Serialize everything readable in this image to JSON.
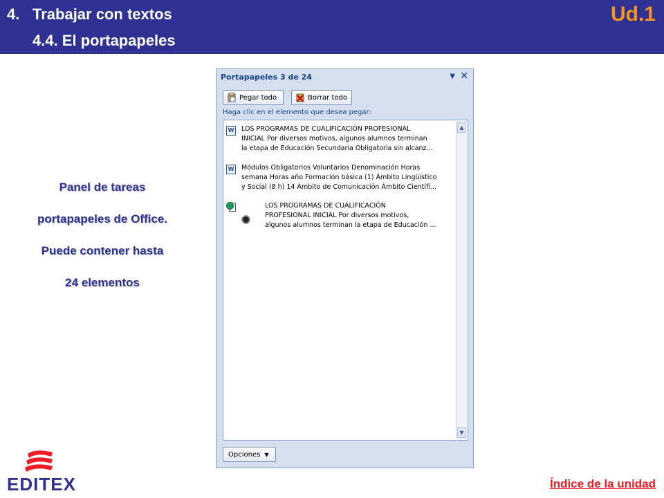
{
  "header": {
    "number": "4.",
    "title": "Trabajar con textos",
    "subtitle": "4.4. El portapapeles",
    "unit": "Ud.1"
  },
  "caption": {
    "lines": [
      "Panel de tareas",
      "portapapeles de Office.",
      "Puede contener hasta",
      "24 elementos"
    ]
  },
  "panel": {
    "title": "Portapapeles 3 de 24",
    "dropdown_icon": "▼",
    "close_icon": "✕",
    "paste_all": "Pegar todo",
    "clear_all": "Borrar todo",
    "hint": "Haga clic en el elemento que desea pegar:",
    "items": [
      {
        "icon": "word-doc-icon",
        "lines": [
          "LOS PROGRAMAS DE CUALIFICACIÓN PROFESIONAL",
          "INICIAL Por diversos motivos, algunos alumnos terminan",
          "la etapa de Educación Secundaria Obligatoria sin alcanz..."
        ]
      },
      {
        "icon": "word-doc-icon",
        "lines": [
          "Módulos Obligatorios Voluntarios Denominación Horas",
          "semana Horas año Formación básica (1) Ámbito Lingüístico",
          "y Social (8 h) 14 Ámbito de Comunicación Ámbito Científi..."
        ]
      },
      {
        "icon": "web-doc-icon",
        "lines": [
          "LOS PROGRAMAS DE CUALIFICACIÓN",
          "PROFESIONAL INICIAL Por diversos motivos,",
          "algunos alumnos terminan la etapa de Educación ..."
        ]
      }
    ],
    "options": "Opciones"
  },
  "footer": {
    "logo": "EDITEX",
    "index_link": "Índice de la unidad"
  },
  "colors": {
    "header_bg": "#2e3192",
    "unit_accent": "#f7941d",
    "caption": "#2e3192",
    "link": "#ed1c24"
  }
}
